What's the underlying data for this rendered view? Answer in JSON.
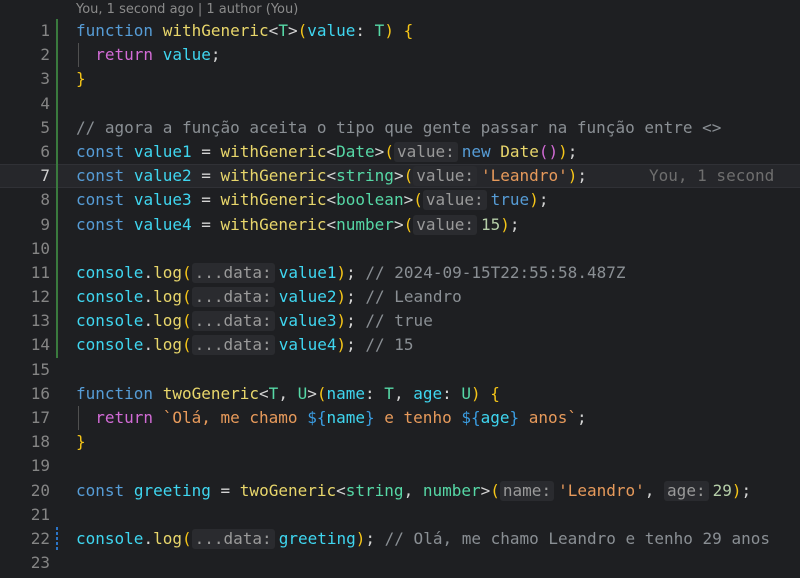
{
  "blame_header": "You, 1 second ago | 1 author (You)",
  "current_line_blame": "You, 1 second",
  "hints": {
    "value": "value:",
    "data": "...data:",
    "name": "name:",
    "age": "age:"
  },
  "line_numbers": [
    "1",
    "2",
    "3",
    "4",
    "5",
    "6",
    "7",
    "8",
    "9",
    "10",
    "11",
    "12",
    "13",
    "14",
    "15",
    "16",
    "17",
    "18",
    "19",
    "20",
    "21",
    "22",
    "23"
  ],
  "tokens": {
    "function": "function",
    "const": "const",
    "return": "return",
    "new": "new",
    "console": "console",
    "log": "log",
    "withGeneric": "withGeneric",
    "twoGeneric": "twoGeneric",
    "T": "T",
    "U": "U",
    "Date": "Date",
    "string": "string",
    "boolean": "boolean",
    "number": "number",
    "value": "value",
    "value1": "value1",
    "value2": "value2",
    "value3": "value3",
    "value4": "value4",
    "name": "name",
    "age": "age",
    "greeting": "greeting",
    "true": "true",
    "15": "15",
    "29": "29",
    "leandro": "'Leandro'"
  },
  "comments": {
    "line5": "// agora a função aceita o tipo que gente passar na função entre <>",
    "line11": "// 2024-09-15T22:55:58.487Z",
    "line12": "// Leandro",
    "line13": "// true",
    "line14": "// 15",
    "line22": "// Olá, me chamo Leandro e tenho 29 anos"
  },
  "template": {
    "part1": "`Olá, me chamo ",
    "part2": " e tenho ",
    "part3": " anos`"
  }
}
